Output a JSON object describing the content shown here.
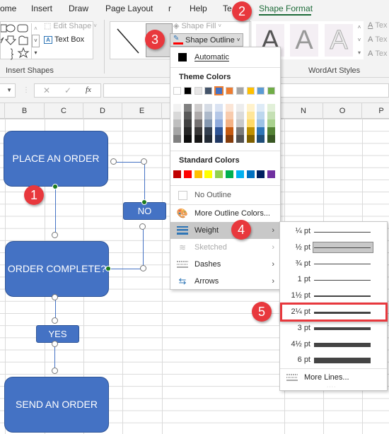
{
  "ribbon": {
    "tabs": [
      {
        "label": "ome",
        "active": false
      },
      {
        "label": "Insert",
        "active": false
      },
      {
        "label": "Draw",
        "active": false
      },
      {
        "label": "Page Layout",
        "active": false
      },
      {
        "label": "r",
        "active": false
      },
      {
        "label": "Help",
        "active": false
      },
      {
        "label": "Te",
        "active": false
      },
      {
        "label": "Shape Format",
        "active": true
      }
    ],
    "insert_shapes": {
      "edit_shape_label": "Edit Shape",
      "text_box_label": "Text Box",
      "group_label": "Insert Shapes"
    },
    "shape_styles": {
      "shape_fill_label": "Shape Fill",
      "shape_outline_label": "Shape Outline"
    },
    "wordart": {
      "sample_glyph": "A",
      "text_fill_label": "Tex",
      "text_outline_label": "Tex",
      "text_effects_label": "Tex",
      "group_label": "WordArt Styles"
    }
  },
  "formula_bar": {
    "cancel_icon": "✕",
    "enter_icon": "✓",
    "fx_label": "fx",
    "value": ""
  },
  "columns": [
    "B",
    "C",
    "D",
    "E",
    "N",
    "O",
    "P"
  ],
  "flowchart": {
    "place_order": "PLACE AN ORDER",
    "order_complete": "ORDER COMPLETE?",
    "no_label": "NO",
    "yes_label": "YES",
    "send_order": "SEND AN ORDER",
    "shape_color": "#4472c4",
    "connector_color": "#4472c4"
  },
  "outline_menu": {
    "automatic_label": "Automatic",
    "theme_colors_heading": "Theme Colors",
    "theme_colors": [
      "#ffffff",
      "#000000",
      "#e7e6e6",
      "#44546a",
      "#4472c4",
      "#ed7d31",
      "#a5a5a5",
      "#ffc000",
      "#5b9bd5",
      "#70ad47"
    ],
    "theme_tints": [
      [
        "#f2f2f2",
        "#d9d9d9",
        "#bfbfbf",
        "#a6a6a6",
        "#808080"
      ],
      [
        "#808080",
        "#595959",
        "#404040",
        "#262626",
        "#0d0d0d"
      ],
      [
        "#d0cece",
        "#aeaaaa",
        "#757171",
        "#3a3838",
        "#171616"
      ],
      [
        "#d6dce5",
        "#adb9ca",
        "#8497b0",
        "#333f50",
        "#222a35"
      ],
      [
        "#dae3f3",
        "#b4c7e7",
        "#8faadc",
        "#2f5597",
        "#203864"
      ],
      [
        "#fbe5d6",
        "#f8cbad",
        "#f4b183",
        "#c55a11",
        "#843c0c"
      ],
      [
        "#ededed",
        "#dbdbdb",
        "#c9c9c9",
        "#7b7b7b",
        "#525252"
      ],
      [
        "#fff2cc",
        "#ffe699",
        "#ffd966",
        "#bf9000",
        "#7f6000"
      ],
      [
        "#deebf7",
        "#bdd7ee",
        "#9dc3e6",
        "#2e75b6",
        "#1f4e79"
      ],
      [
        "#e2f0d9",
        "#c5e0b4",
        "#a9d18e",
        "#548235",
        "#385723"
      ]
    ],
    "selected_theme_index": 4,
    "standard_colors_heading": "Standard Colors",
    "standard_colors": [
      "#c00000",
      "#ff0000",
      "#ffc000",
      "#ffff00",
      "#92d050",
      "#00b050",
      "#00b0f0",
      "#0070c0",
      "#002060",
      "#7030a0"
    ],
    "no_outline_label": "No Outline",
    "more_colors_label": "More Outline Colors...",
    "weight_label": "Weight",
    "sketched_label": "Sketched",
    "dashes_label": "Dashes",
    "arrows_label": "Arrows",
    "arrow_glyph": "›"
  },
  "weight_menu": {
    "items": [
      {
        "label": "¼ pt",
        "weight_pt": 0.25
      },
      {
        "label": "½ pt",
        "weight_pt": 0.5,
        "selected": true
      },
      {
        "label": "¾ pt",
        "weight_pt": 0.75
      },
      {
        "label": "1 pt",
        "weight_pt": 1
      },
      {
        "label": "1½ pt",
        "weight_pt": 1.5
      },
      {
        "label": "2¼ pt",
        "weight_pt": 2.25,
        "highlighted": true
      },
      {
        "label": "3 pt",
        "weight_pt": 3
      },
      {
        "label": "4½ pt",
        "weight_pt": 4.5
      },
      {
        "label": "6 pt",
        "weight_pt": 6
      }
    ],
    "more_lines_label": "More Lines..."
  },
  "callouts": [
    "1",
    "2",
    "3",
    "4",
    "5"
  ],
  "colors": {
    "accent_green": "#1e6b39",
    "callout_red": "#e8383d"
  }
}
